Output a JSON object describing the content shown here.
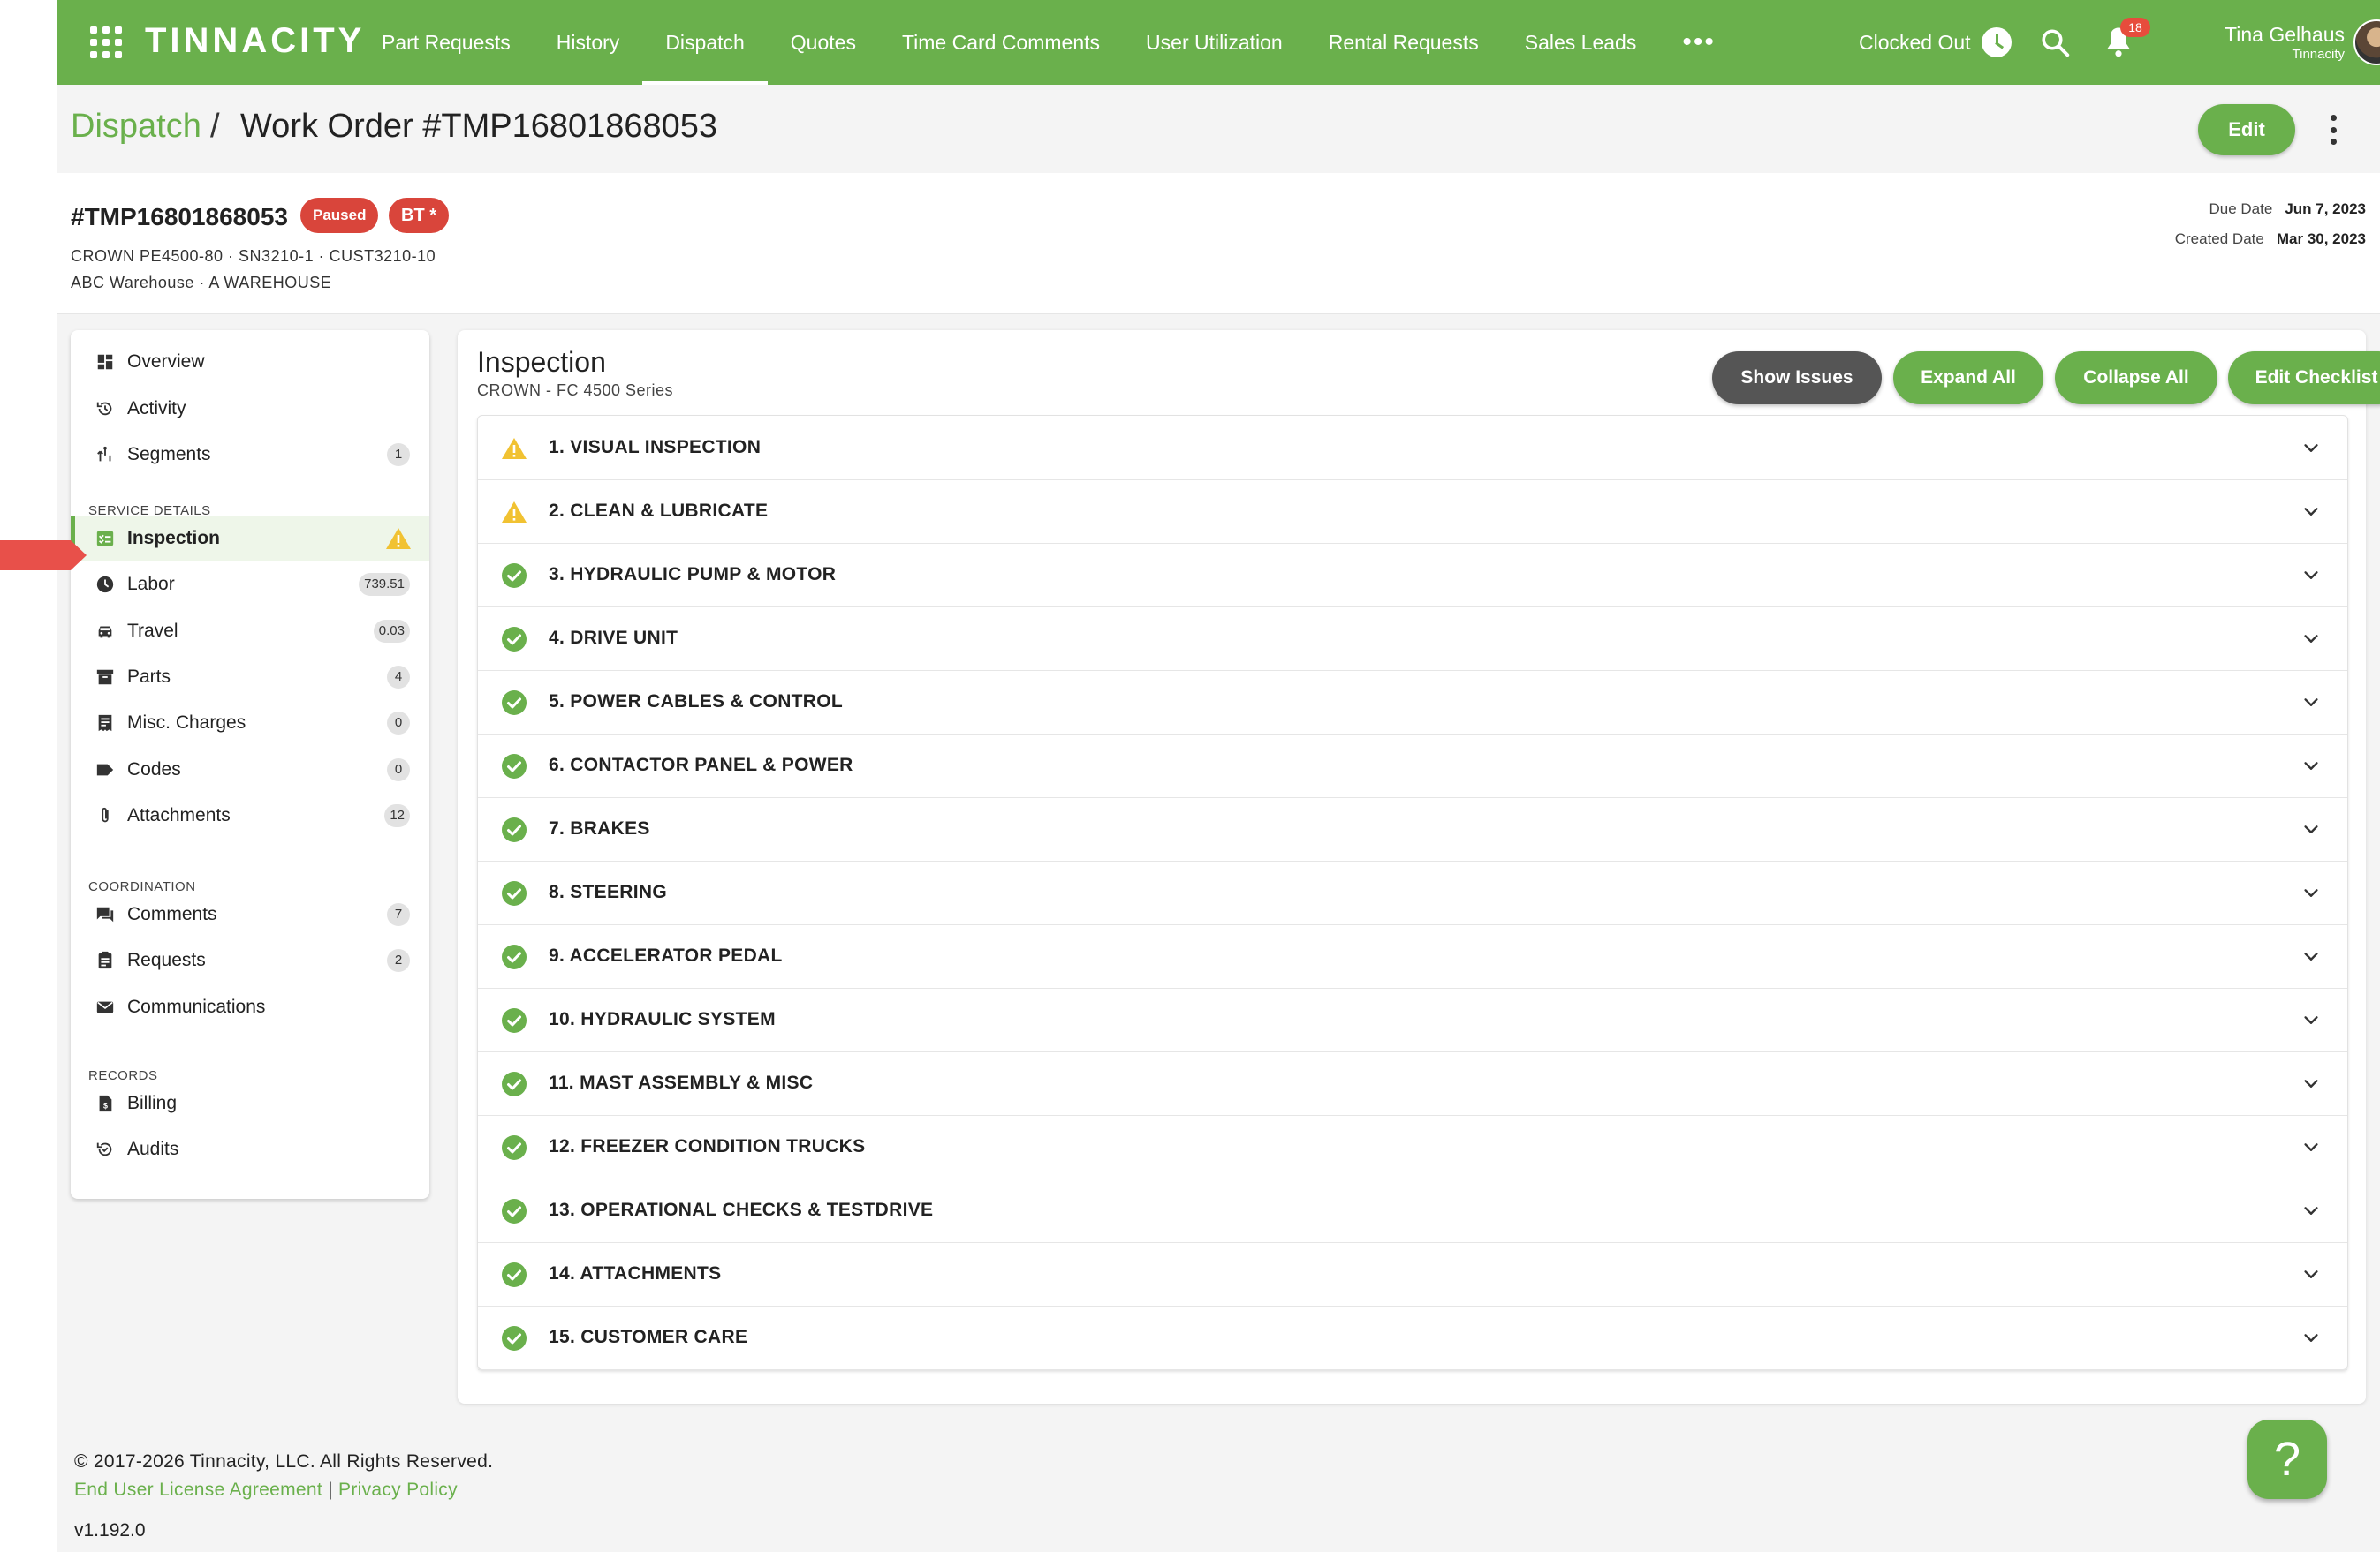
{
  "nav": {
    "logo": "TINNACITY",
    "items": [
      {
        "label": "Part Requests",
        "active": false
      },
      {
        "label": "History",
        "active": false
      },
      {
        "label": "Dispatch",
        "active": true
      },
      {
        "label": "Quotes",
        "active": false
      },
      {
        "label": "Time Card Comments",
        "active": false
      },
      {
        "label": "User Utilization",
        "active": false
      },
      {
        "label": "Rental Requests",
        "active": false
      },
      {
        "label": "Sales Leads",
        "active": false
      }
    ],
    "more": "•••",
    "clock_status": "Clocked Out",
    "notification_count": "18",
    "user_name": "Tina Gelhaus",
    "user_org": "Tinnacity"
  },
  "breadcrumb": {
    "parent": "Dispatch",
    "separator": "/",
    "title": "Work Order #TMP16801868053"
  },
  "header_actions": {
    "edit_label": "Edit"
  },
  "work_order": {
    "number": "#TMP16801868053",
    "status_badge": "Paused",
    "tag_badge": "BT *",
    "equipment_line": "CROWN PE4500-80 · SN3210-1 · CUST3210-10",
    "location_line": "ABC Warehouse · A WAREHOUSE",
    "due_date_label": "Due Date",
    "due_date": "Jun 7, 2023",
    "created_date_label": "Created Date",
    "created_date": "Mar 30, 2023"
  },
  "sidebar": {
    "top_items": [
      {
        "label": "Overview",
        "icon": "dashboard-icon",
        "count": ""
      },
      {
        "label": "Activity",
        "icon": "history-icon",
        "count": ""
      },
      {
        "label": "Segments",
        "icon": "segments-icon",
        "count": "1"
      }
    ],
    "service_section": "SERVICE DETAILS",
    "service_items": [
      {
        "label": "Inspection",
        "icon": "checklist-icon",
        "count": "",
        "active": true,
        "warning": true
      },
      {
        "label": "Labor",
        "icon": "clock-icon",
        "count": "739.51"
      },
      {
        "label": "Travel",
        "icon": "car-icon",
        "count": "0.03"
      },
      {
        "label": "Parts",
        "icon": "box-icon",
        "count": "4"
      },
      {
        "label": "Misc. Charges",
        "icon": "receipt-icon",
        "count": "0"
      },
      {
        "label": "Codes",
        "icon": "tag-icon",
        "count": "0"
      },
      {
        "label": "Attachments",
        "icon": "paperclip-icon",
        "count": "12"
      }
    ],
    "coordination_section": "COORDINATION",
    "coordination_items": [
      {
        "label": "Comments",
        "icon": "comments-icon",
        "count": "7"
      },
      {
        "label": "Requests",
        "icon": "clipboard-icon",
        "count": "2"
      },
      {
        "label": "Communications",
        "icon": "mail-icon",
        "count": ""
      }
    ],
    "records_section": "RECORDS",
    "records_items": [
      {
        "label": "Billing",
        "icon": "invoice-icon",
        "count": ""
      },
      {
        "label": "Audits",
        "icon": "audit-icon",
        "count": ""
      }
    ]
  },
  "inspection": {
    "title": "Inspection",
    "subtitle": "CROWN - FC 4500 Series",
    "buttons": {
      "show_issues": "Show Issues",
      "expand_all": "Expand All",
      "collapse_all": "Collapse All",
      "edit_checklist": "Edit Checklist"
    },
    "sections": [
      {
        "label": "1. VISUAL INSPECTION",
        "status": "warning"
      },
      {
        "label": "2. CLEAN & LUBRICATE",
        "status": "warning"
      },
      {
        "label": "3. HYDRAULIC PUMP & MOTOR",
        "status": "ok"
      },
      {
        "label": "4. DRIVE UNIT",
        "status": "ok"
      },
      {
        "label": "5. POWER CABLES & CONTROL",
        "status": "ok"
      },
      {
        "label": "6. CONTACTOR PANEL & POWER",
        "status": "ok"
      },
      {
        "label": "7. BRAKES",
        "status": "ok"
      },
      {
        "label": "8. STEERING",
        "status": "ok"
      },
      {
        "label": "9. ACCELERATOR PEDAL",
        "status": "ok"
      },
      {
        "label": "10. HYDRAULIC SYSTEM",
        "status": "ok"
      },
      {
        "label": "11. MAST ASSEMBLY & MISC",
        "status": "ok"
      },
      {
        "label": "12. FREEZER CONDITION TRUCKS",
        "status": "ok"
      },
      {
        "label": "13. OPERATIONAL CHECKS & TESTDRIVE",
        "status": "ok"
      },
      {
        "label": "14. ATTACHMENTS",
        "status": "ok"
      },
      {
        "label": "15. CUSTOMER CARE",
        "status": "ok"
      }
    ]
  },
  "footer": {
    "copyright": "© 2017-2026 Tinnacity, LLC. All Rights Reserved.",
    "eula": "End User License Agreement",
    "divider": "|",
    "privacy": "Privacy Policy",
    "version": "v1.192.0",
    "help": "?"
  },
  "colors": {
    "brand": "#6ab04c",
    "danger": "#d9453b",
    "warning": "#f1c232",
    "dark_button": "#555555"
  }
}
